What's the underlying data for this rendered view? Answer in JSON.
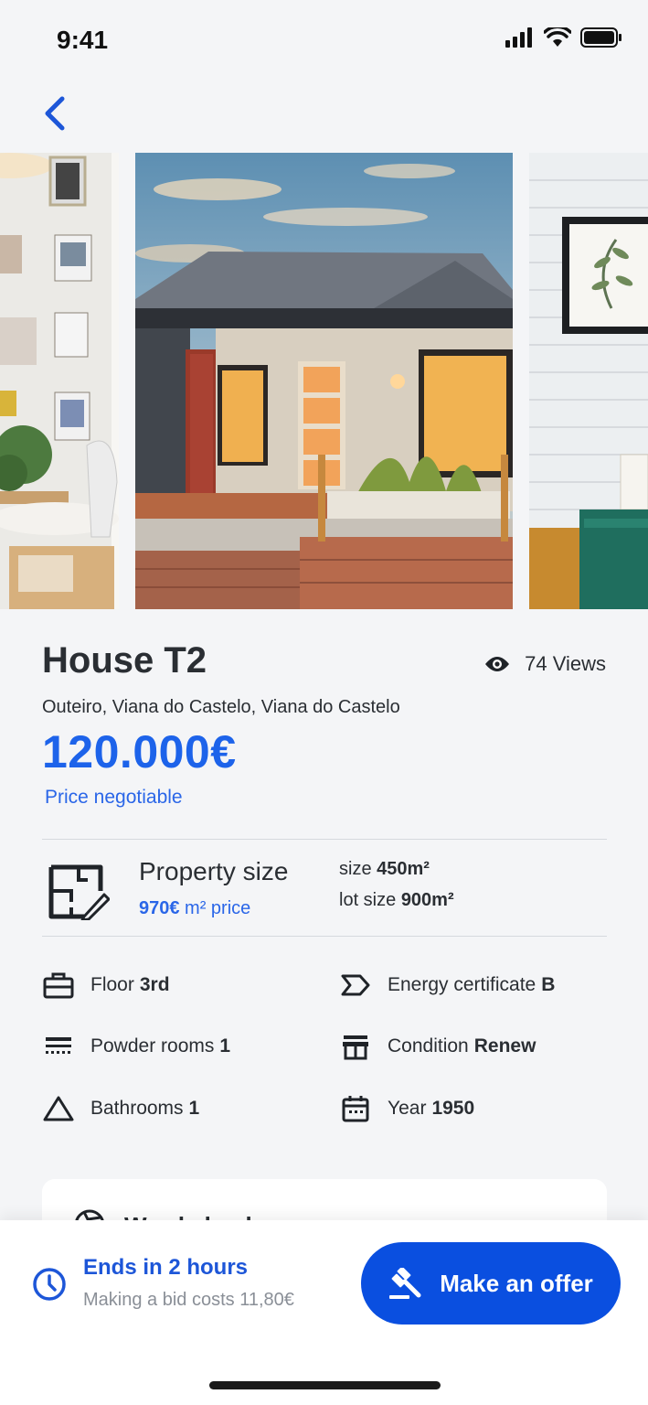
{
  "status_bar": {
    "time": "9:41"
  },
  "listing": {
    "title": "House T2",
    "views_label": "74 Views",
    "address": "Outeiro, Viana do Castelo, Viana do Castelo",
    "price": "120.000€",
    "price_note": "Price negotiable"
  },
  "property_size": {
    "title": "Property size",
    "m2_price": "970€",
    "m2_price_suffix": " m² price",
    "size_label": "size",
    "size_value": "450m²",
    "lot_label": "lot size",
    "lot_value": "900m²"
  },
  "features": [
    {
      "label": "Floor",
      "value": "3rd",
      "icon": "briefcase-icon"
    },
    {
      "label": "Energy certificate",
      "value": "B",
      "icon": "energy-tag-icon"
    },
    {
      "label": "Powder rooms",
      "value": "1",
      "icon": "powder-room-icon"
    },
    {
      "label": "Condition",
      "value": "Renew",
      "icon": "storefront-icon"
    },
    {
      "label": "Bathrooms",
      "value": "1",
      "icon": "triangle-icon"
    },
    {
      "label": "Year",
      "value": "1950",
      "icon": "calendar-icon"
    }
  ],
  "card": {
    "title": "Word check"
  },
  "bottom_bar": {
    "ends_label": "Ends in 2 hours",
    "bid_cost": "Making a bid costs 11,80€",
    "offer_button": "Make an offer"
  },
  "colors": {
    "accent": "#1d63ea",
    "button": "#0a4fe0",
    "background": "#f4f5f7"
  }
}
